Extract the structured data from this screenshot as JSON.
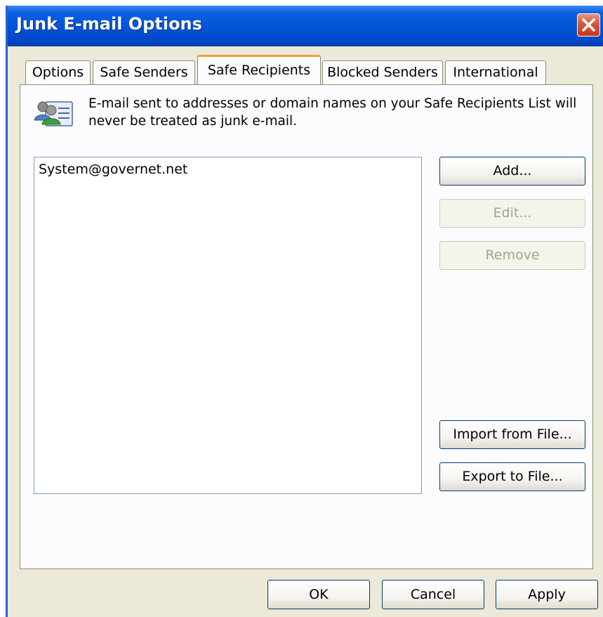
{
  "window": {
    "title": "Junk E-mail Options"
  },
  "tabs": [
    {
      "label": "Options"
    },
    {
      "label": "Safe Senders"
    },
    {
      "label": "Safe Recipients",
      "active": true
    },
    {
      "label": "Blocked Senders"
    },
    {
      "label": "International"
    }
  ],
  "panel": {
    "icon": "contacts-card-icon",
    "description": "E-mail sent to addresses or domain names on your Safe Recipients List will never be treated as junk e-mail.",
    "list_items": [
      "System@governet.net"
    ],
    "buttons": {
      "add": "Add...",
      "edit": "Edit...",
      "remove": "Remove",
      "import": "Import from File...",
      "export": "Export to File..."
    }
  },
  "footer": {
    "ok": "OK",
    "cancel": "Cancel",
    "apply": "Apply"
  },
  "colors": {
    "titlebar": "#0353d8",
    "active_tab_accent": "#f2a235",
    "dialog_bg": "#ece9d8"
  }
}
